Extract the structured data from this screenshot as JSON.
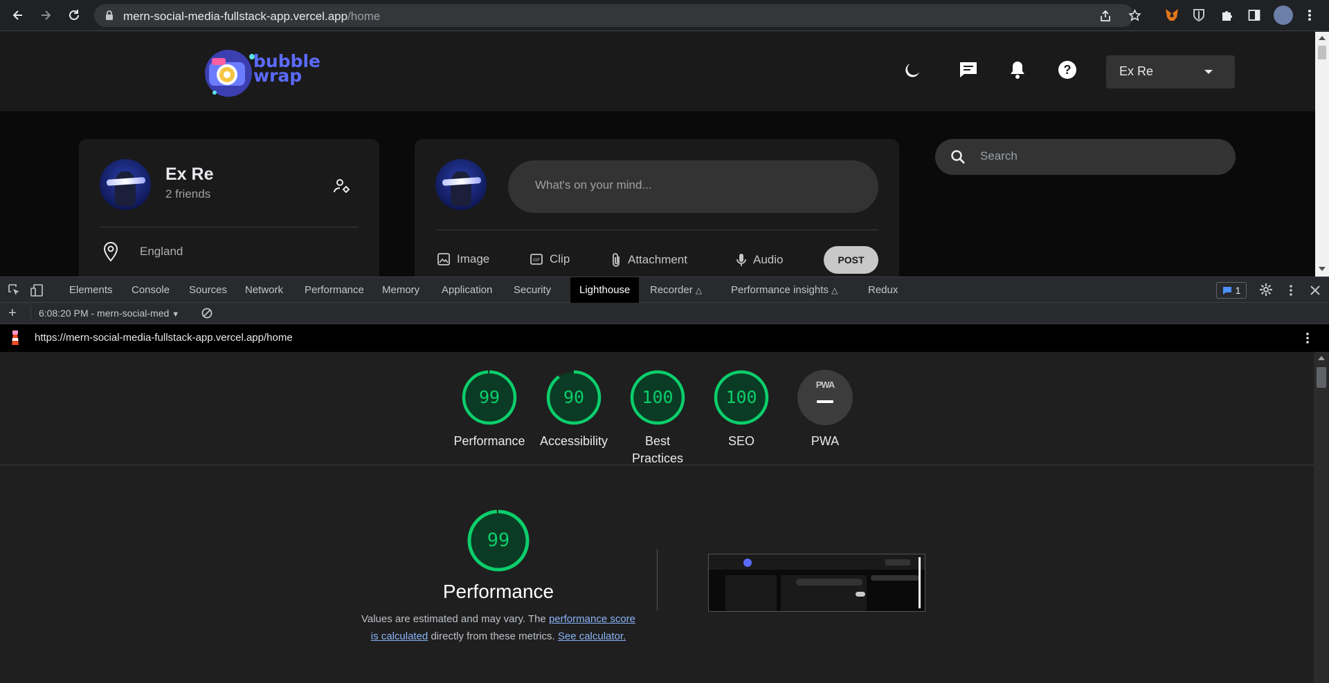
{
  "browser": {
    "url_host": "mern-social-media-fullstack-app.vercel.app",
    "url_path": "/home"
  },
  "app": {
    "logo_text": "bubble wrap",
    "user_select": {
      "value": "Ex Re"
    },
    "search": {
      "placeholder": "Search"
    },
    "profile": {
      "name": "Ex Re",
      "friends": "2 friends",
      "location": "England"
    },
    "composer": {
      "placeholder": "What's on your mind...",
      "actions": [
        "Image",
        "Clip",
        "Attachment",
        "Audio"
      ],
      "post_label": "POST"
    }
  },
  "devtools": {
    "tabs": [
      "Elements",
      "Console",
      "Sources",
      "Network",
      "Performance",
      "Memory",
      "Application",
      "Security",
      "Lighthouse",
      "Recorder",
      "Performance insights",
      "Redux"
    ],
    "active_tab": "Lighthouse",
    "issues_count": "1",
    "report_select": "6:08:20 PM - mern-social-med",
    "report_url": "https://mern-social-media-fullstack-app.vercel.app/home"
  },
  "lighthouse": {
    "scores": [
      {
        "label": "Performance",
        "value": "99",
        "fraction": 0.99
      },
      {
        "label": "Accessibility",
        "value": "90",
        "fraction": 0.9
      },
      {
        "label": "Best Practices",
        "value": "100",
        "fraction": 1.0
      },
      {
        "label": "SEO",
        "value": "100",
        "fraction": 1.0
      },
      {
        "label": "PWA",
        "value": "PWA",
        "fraction": 0
      }
    ],
    "main": {
      "score": "99",
      "fraction": 0.99,
      "title": "Performance",
      "desc_prefix": "Values are estimated and may vary. The",
      "link1": "performance score is calculated",
      "desc_mid": "directly from these metrics.",
      "link2": "See calculator."
    }
  },
  "colors": {
    "pass": "#0cce6b",
    "pwa_bg": "#3c3c3c"
  }
}
